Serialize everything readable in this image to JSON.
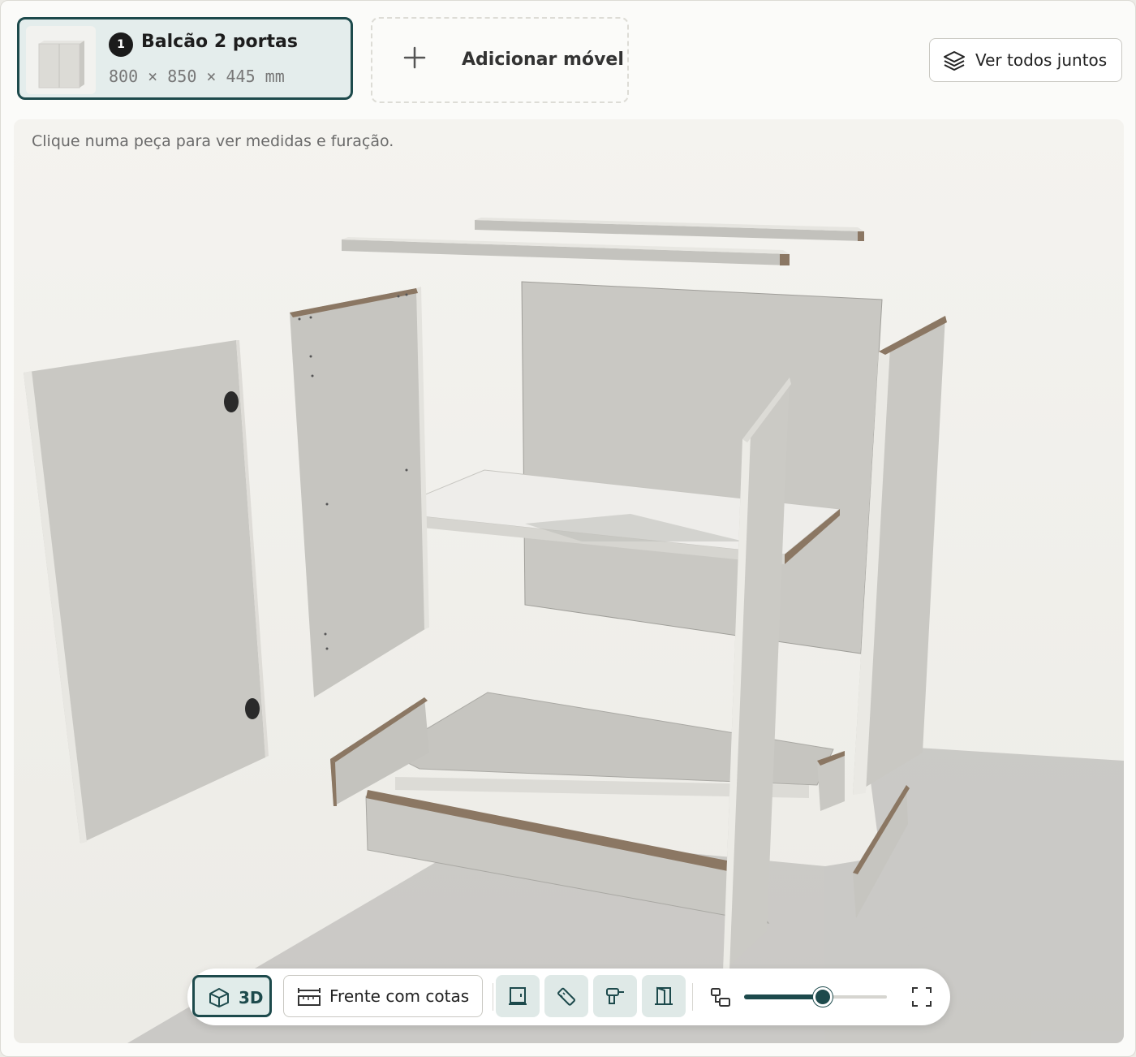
{
  "furniture_card": {
    "index": "1",
    "title": "Balcão 2 portas",
    "dimensions": "800 × 850 × 445 mm"
  },
  "add_furniture": {
    "label": "Adicionar móvel"
  },
  "view_all": {
    "label": "Ver todos juntos",
    "icon": "layers-icon"
  },
  "viewport": {
    "hint": "Clique numa peça para ver medidas e furação."
  },
  "toolbar": {
    "mode_3d_label": "3D",
    "front_dims_label": "Frente com cotas",
    "tools": [
      "cabinet-view-icon",
      "ruler-icon",
      "drill-icon",
      "door-icon"
    ],
    "explode_level": 0.55
  },
  "colors": {
    "accent": "#1d4a4c",
    "accent_light": "#e1ecea",
    "panel": "#c9c8c3",
    "panel_edge": "#e8e7e2",
    "edge_band": "#8b7763"
  }
}
